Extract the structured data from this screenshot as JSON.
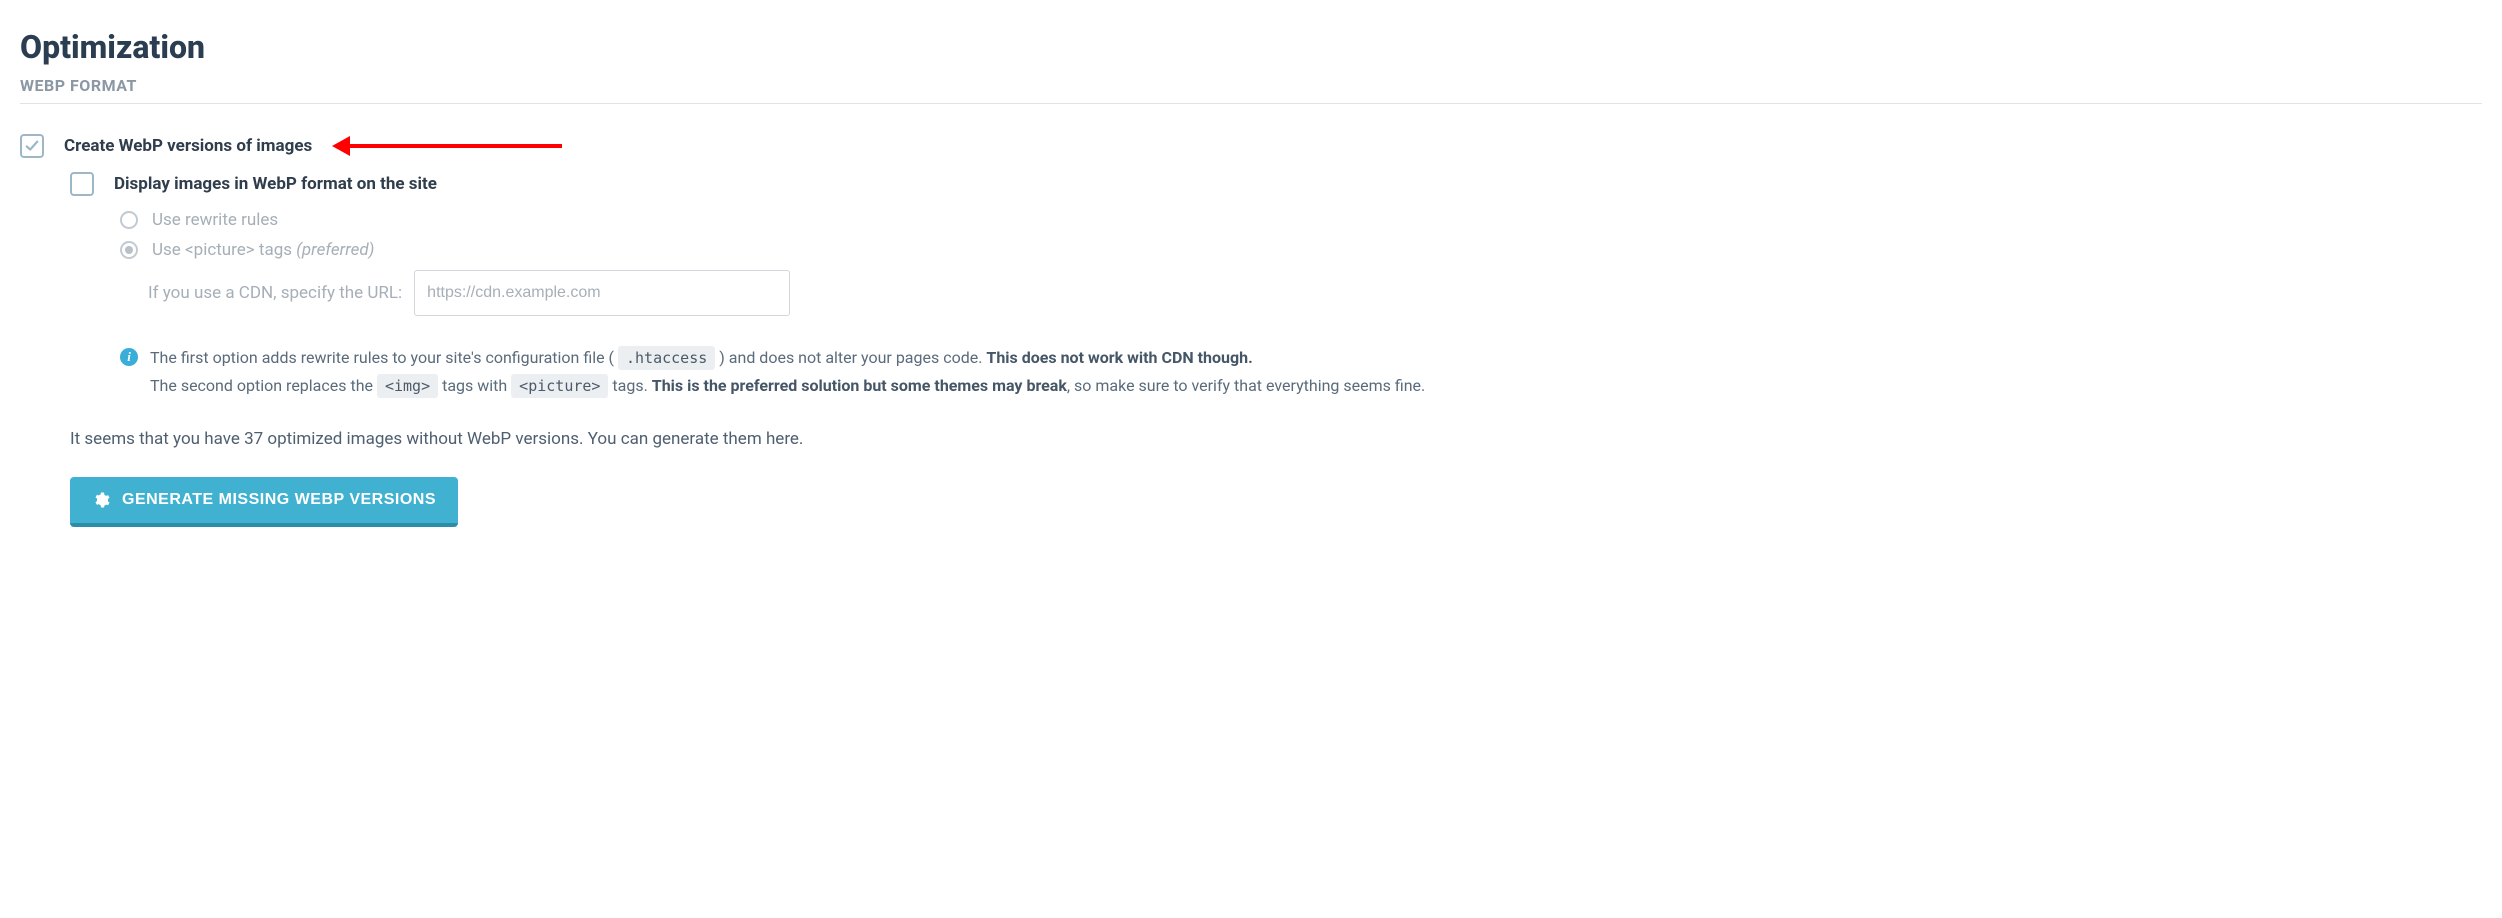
{
  "header": {
    "title": "Optimization",
    "section": "WEBP FORMAT"
  },
  "options": {
    "create_webp": {
      "label": "Create WebP versions of images",
      "checked": true
    },
    "display_webp": {
      "label": "Display images in WebP format on the site",
      "checked": false
    }
  },
  "method": {
    "rewrite_label": "Use rewrite rules",
    "picture_label_prefix": "Use <picture> tags ",
    "picture_label_suffix": "(preferred)",
    "selected": "picture",
    "cdn_caption": "If you use a CDN, specify the URL:",
    "cdn_placeholder": "https://cdn.example.com",
    "cdn_value": ""
  },
  "info": {
    "line1_a": "The first option adds rewrite rules to your site's configuration file ( ",
    "code_htaccess": ".htaccess",
    "line1_b": " ) and does not alter your pages code. ",
    "line1_strong": "This does not work with CDN though.",
    "line2_a": "The second option replaces the ",
    "code_img": "<img>",
    "line2_b": " tags with ",
    "code_picture": "<picture>",
    "line2_c": " tags. ",
    "line2_strong": "This is the preferred solution but some themes may break",
    "line2_d": ", so make sure to verify that everything seems fine."
  },
  "hint": "It seems that you have 37 optimized images without WebP versions. You can generate them here.",
  "actions": {
    "generate_label": "Generate Missing WebP Versions"
  },
  "icons": {
    "info": "info-icon",
    "gear": "gear-icon",
    "check": "check-icon"
  },
  "colors": {
    "accent": "#40b1d0",
    "accent_dark": "#2a8daa",
    "annotation": "#ff0000"
  }
}
